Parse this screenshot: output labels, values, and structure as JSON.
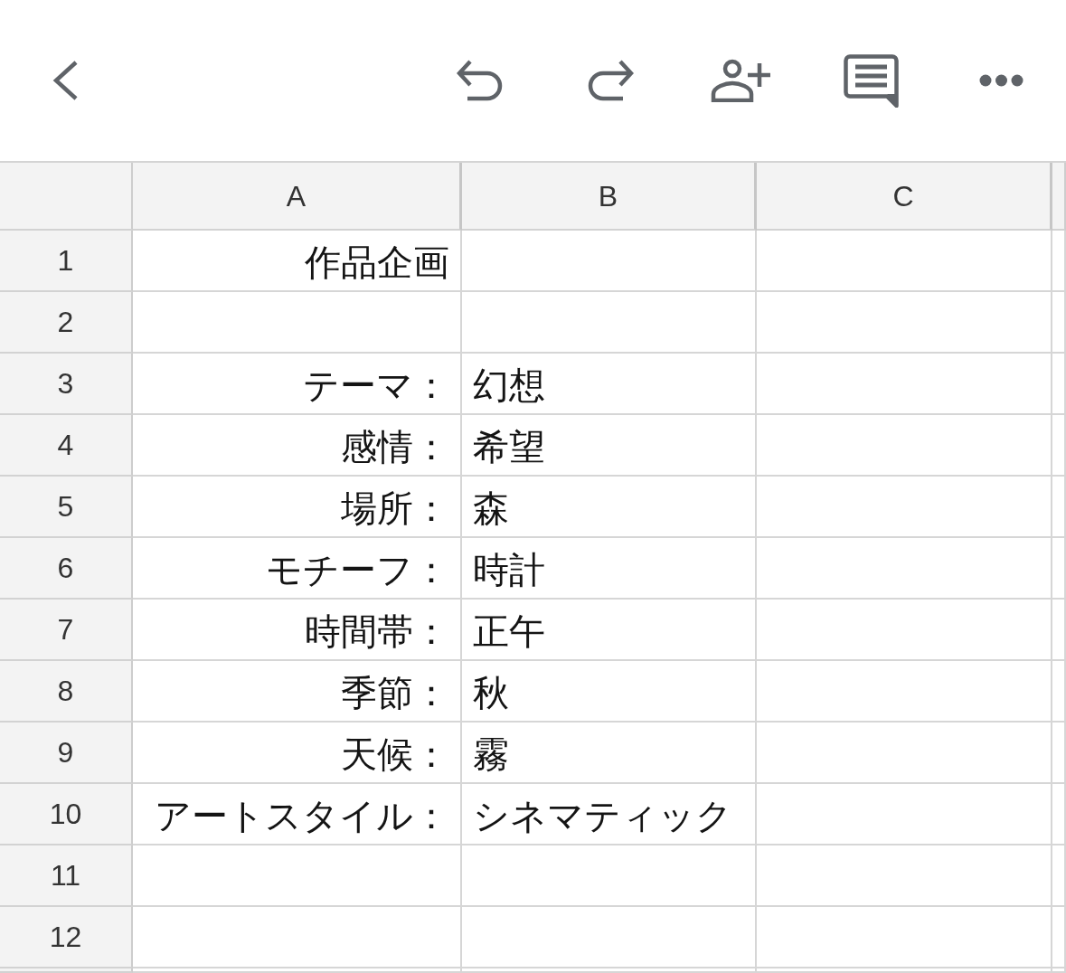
{
  "sheet": {
    "columns": [
      {
        "label": "A",
        "kind": "right"
      },
      {
        "label": "B",
        "kind": "left"
      },
      {
        "label": "C",
        "kind": "left"
      }
    ],
    "rows": [
      {
        "number": "1",
        "a": "作品企画"
      },
      {
        "number": "2"
      },
      {
        "number": "3",
        "a": "テーマ：",
        "b": "幻想"
      },
      {
        "number": "4",
        "a": "感情：",
        "b": "希望"
      },
      {
        "number": "5",
        "a": "場所：",
        "b": "森"
      },
      {
        "number": "6",
        "a": "モチーフ：",
        "b": "時計"
      },
      {
        "number": "7",
        "a": "時間帯：",
        "b": "正午"
      },
      {
        "number": "8",
        "a": "季節：",
        "b": "秋"
      },
      {
        "number": "9",
        "a": "天候：",
        "b": "霧"
      },
      {
        "number": "10",
        "a": "アートスタイル：",
        "b": "シネマティック"
      },
      {
        "number": "11"
      },
      {
        "number": "12"
      }
    ]
  }
}
